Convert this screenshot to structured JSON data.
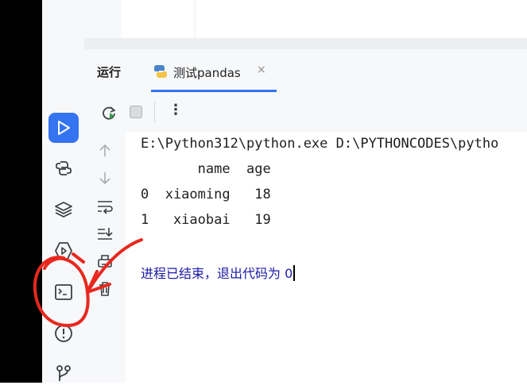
{
  "tool_window": {
    "title": "运行"
  },
  "tab": {
    "label": "测试pandas",
    "close": "×"
  },
  "toolbar": {
    "more": "⋮"
  },
  "console": {
    "command": "E:\\Python312\\python.exe D:\\PYTHONCODES\\pytho",
    "lines": [
      "       name  age",
      "0  xiaoming   18",
      "1   xiaobai   19"
    ],
    "exit_message": "进程已结束，退出代码为 0"
  },
  "sidebar": {
    "items": [
      {
        "icon": "run-icon",
        "active": true
      },
      {
        "icon": "python-console-icon"
      },
      {
        "icon": "layers-icon"
      },
      {
        "icon": "services-icon"
      },
      {
        "icon": "terminal-icon"
      },
      {
        "icon": "problems-icon"
      },
      {
        "icon": "git-icon"
      }
    ]
  },
  "colors": {
    "accent": "#3574f0",
    "annotation": "#e8281e",
    "exit_text": "#1a1aa6"
  }
}
